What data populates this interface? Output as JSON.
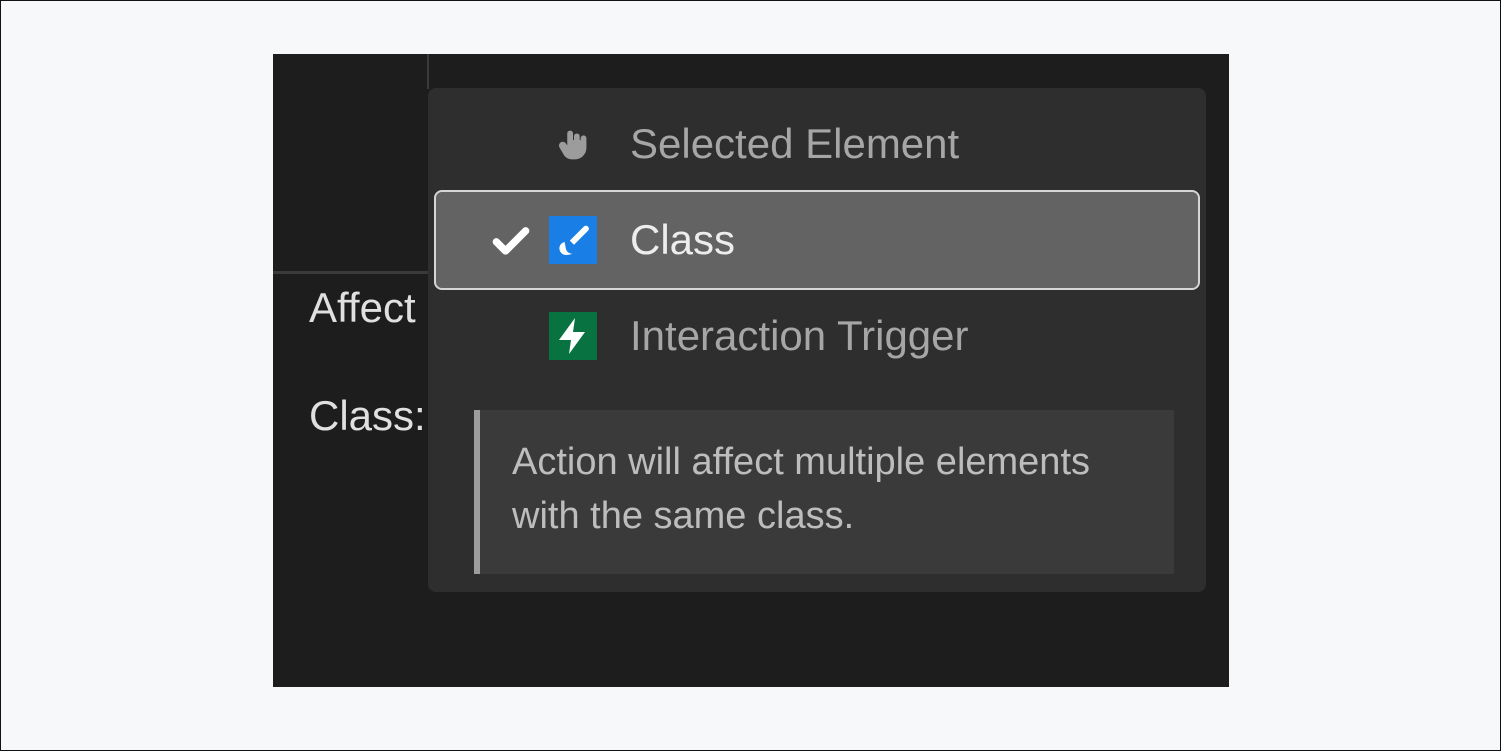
{
  "panel": {
    "left_labels": {
      "affect": "Affect",
      "class": "Class:"
    }
  },
  "dropdown": {
    "options": [
      {
        "label": "Selected Element",
        "icon": "pointer",
        "selected": false
      },
      {
        "label": "Class",
        "icon": "brush",
        "selected": true
      },
      {
        "label": "Interaction Trigger",
        "icon": "bolt",
        "selected": false
      }
    ],
    "hint": "Action will affect multiple elements with the same class."
  },
  "colors": {
    "brush_bg": "#197fe6",
    "bolt_bg": "#087341"
  }
}
